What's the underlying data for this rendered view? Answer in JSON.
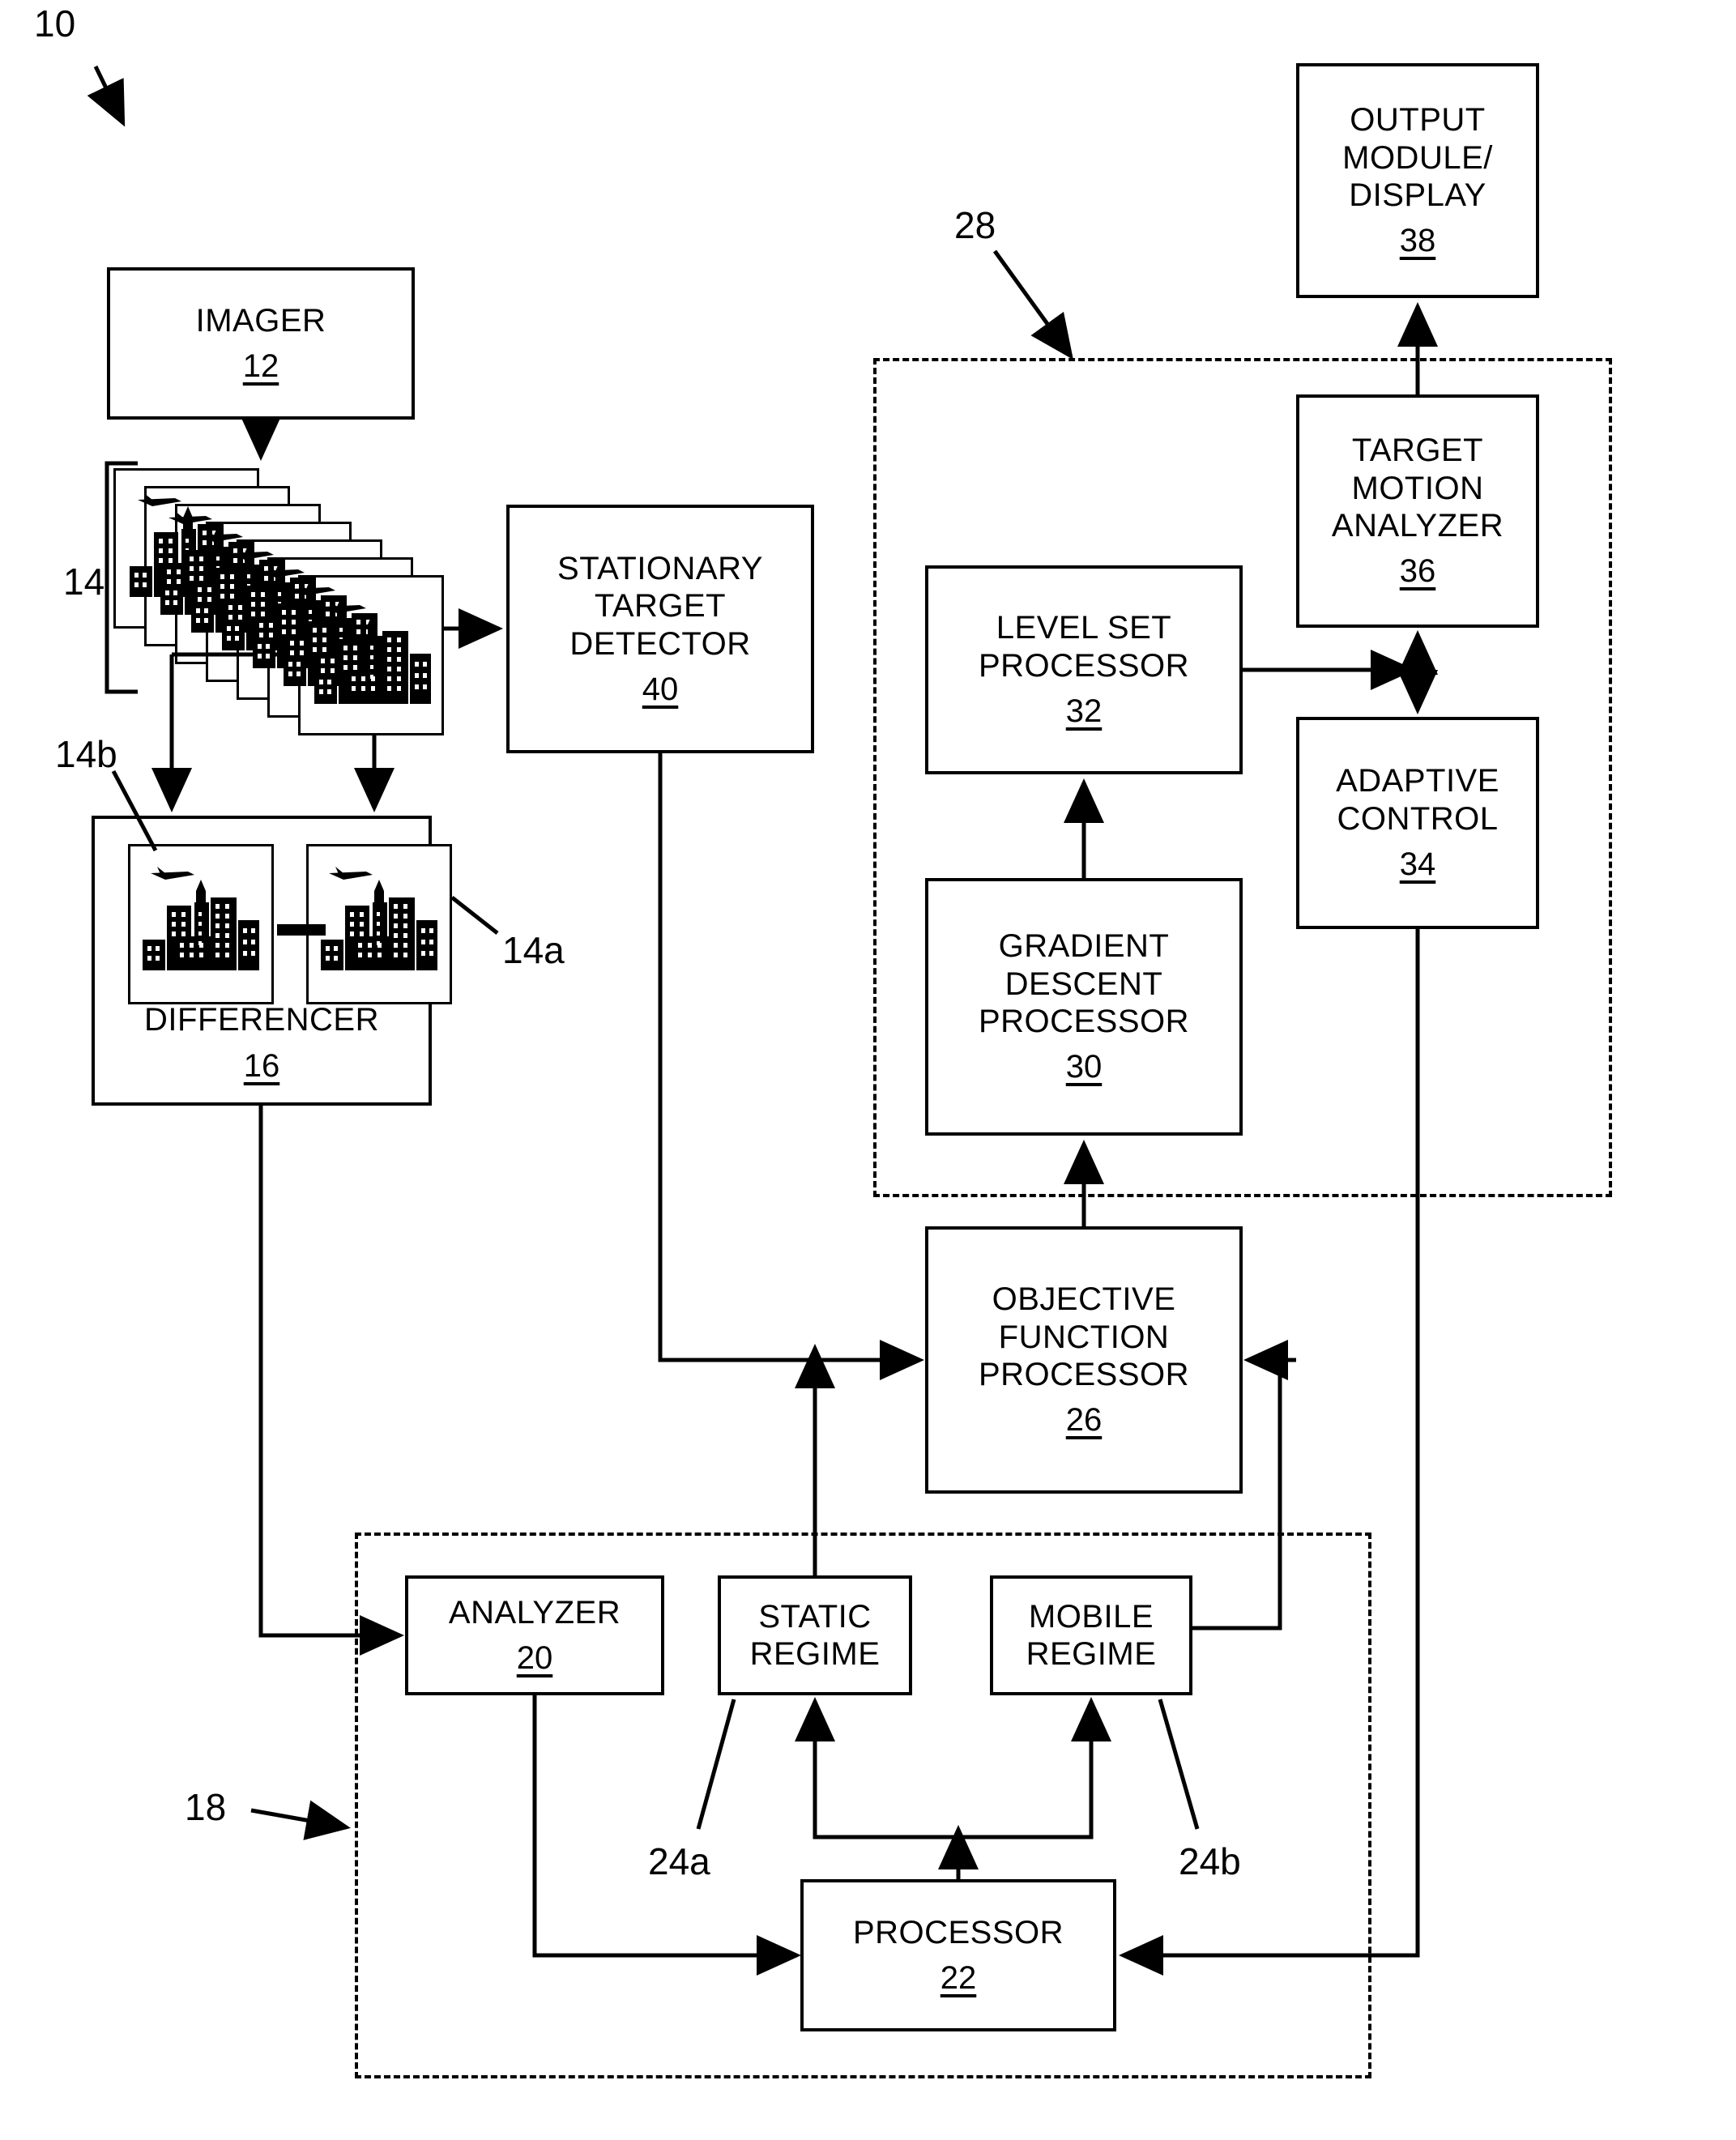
{
  "figure": {
    "system_ref": "10",
    "type": "patent-block-diagram"
  },
  "blocks": {
    "imager": {
      "title": "IMAGER",
      "num": "12"
    },
    "detector": {
      "title": "STATIONARY\nTARGET\nDETECTOR",
      "num": "40"
    },
    "differencer": {
      "title": "DIFFERENCER",
      "num": "16"
    },
    "output": {
      "title": "OUTPUT\nMODULE/\nDISPLAY",
      "num": "38"
    },
    "tma": {
      "title": "TARGET\nMOTION\nANALYZER",
      "num": "36"
    },
    "levelset": {
      "title": "LEVEL SET\nPROCESSOR",
      "num": "32"
    },
    "adaptive": {
      "title": "ADAPTIVE\nCONTROL",
      "num": "34"
    },
    "gradient": {
      "title": "GRADIENT\nDESCENT\nPROCESSOR",
      "num": "30"
    },
    "objective": {
      "title": "OBJECTIVE\nFUNCTION\nPROCESSOR",
      "num": "26"
    },
    "analyzer": {
      "title": "ANALYZER",
      "num": "20"
    },
    "static": {
      "title": "STATIC\nREGIME",
      "num": ""
    },
    "mobile": {
      "title": "MOBILE\nREGIME",
      "num": ""
    },
    "processor": {
      "title": "PROCESSOR",
      "num": "22"
    }
  },
  "reference_labels": {
    "system": "10",
    "image_stack": "14",
    "frame_b": "14b",
    "frame_a": "14a",
    "proc_group": "28",
    "regime_group": "18",
    "static_regime": "24a",
    "mobile_regime": "24b"
  },
  "colors": {
    "ink": "#000000",
    "paper": "#ffffff"
  }
}
